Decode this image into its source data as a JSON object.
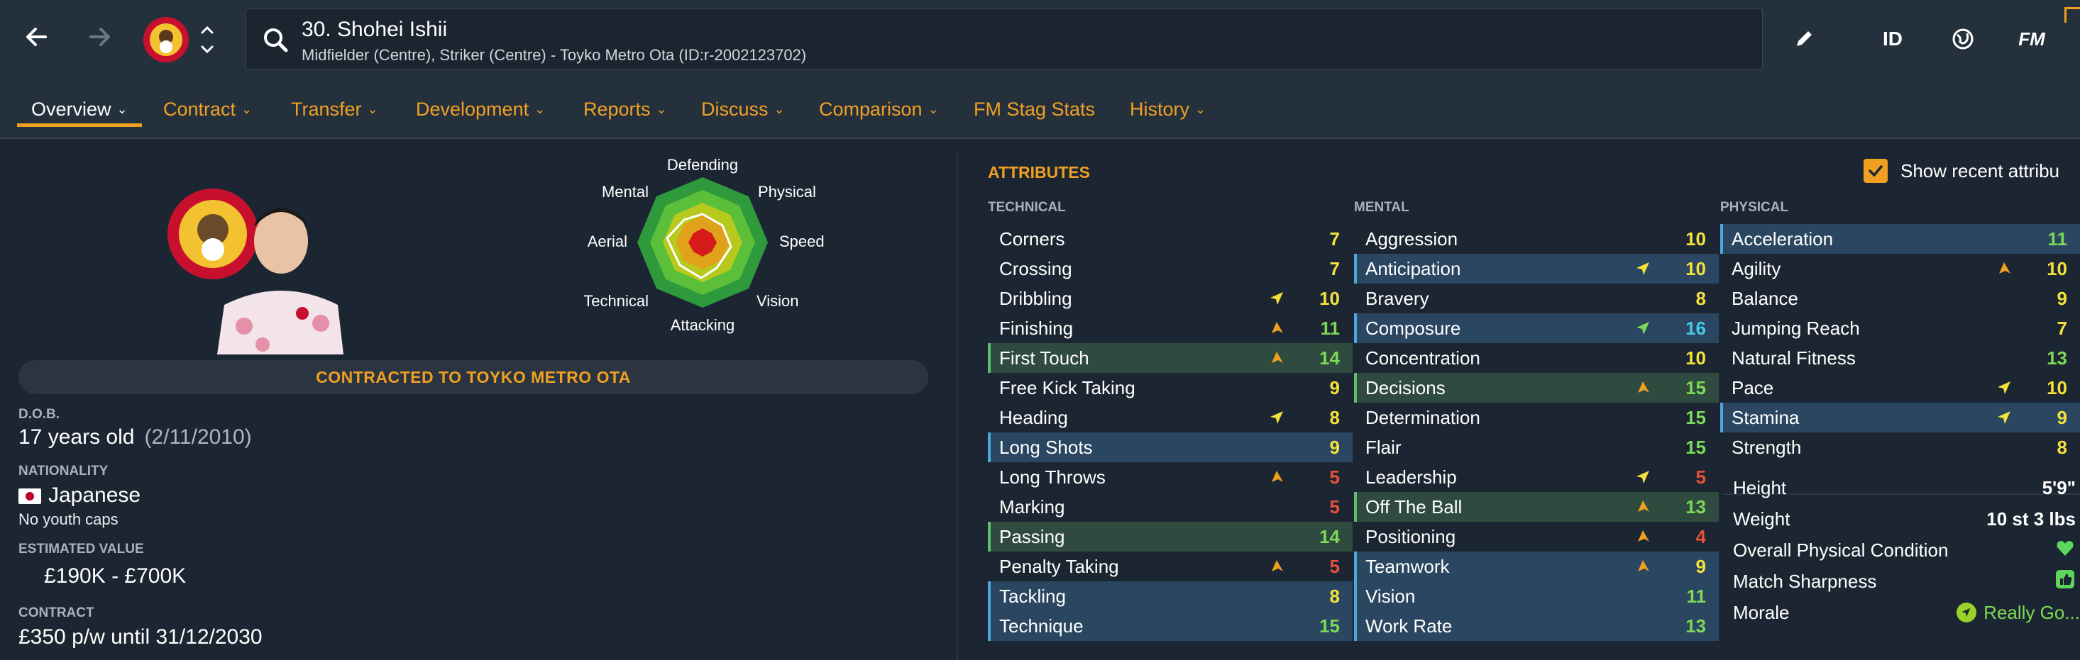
{
  "header": {
    "player_title": "30. Shohei Ishii",
    "player_subtitle": "Midfielder (Centre), Striker (Centre) - Toyko Metro Ota (ID:r-2002123702)",
    "id_label": "ID",
    "fm_label": "FM",
    "accent": "#f0a020"
  },
  "tabs": [
    {
      "label": "Overview"
    },
    {
      "label": "Contract"
    },
    {
      "label": "Transfer"
    },
    {
      "label": "Development"
    },
    {
      "label": "Reports"
    },
    {
      "label": "Discuss"
    },
    {
      "label": "Comparison"
    },
    {
      "label": "FM Stag Stats"
    },
    {
      "label": "History"
    }
  ],
  "radar": {
    "labels": [
      "Defending",
      "Physical",
      "Speed",
      "Vision",
      "Attacking",
      "Technical",
      "Aerial",
      "Mental"
    ]
  },
  "profile": {
    "contract_banner": "CONTRACTED TO TOYKO METRO OTA",
    "dob_label": "D.O.B.",
    "age": "17 years old",
    "dob": "(2/11/2010)",
    "nationality_label": "NATIONALITY",
    "nationality": "Japanese",
    "youth_caps": "No youth caps",
    "value_label": "ESTIMATED VALUE",
    "value": "£190K - £700K",
    "contract_label": "CONTRACT",
    "contract": "£350 p/w until 31/12/2030"
  },
  "attributes": {
    "title": "ATTRIBUTES",
    "show_recent_label": "Show recent attribu",
    "technical_title": "TECHNICAL",
    "mental_title": "MENTAL",
    "physical_title": "PHYSICAL",
    "technical": [
      {
        "name": "Corners",
        "value": "7",
        "color": "yellow",
        "hl": "",
        "arrow": ""
      },
      {
        "name": "Crossing",
        "value": "7",
        "color": "yellow",
        "hl": "",
        "arrow": ""
      },
      {
        "name": "Dribbling",
        "value": "10",
        "color": "yellow",
        "hl": "",
        "arrow": "up-right-yellow"
      },
      {
        "name": "Finishing",
        "value": "11",
        "color": "green",
        "hl": "",
        "arrow": "up-orange"
      },
      {
        "name": "First Touch",
        "value": "14",
        "color": "green",
        "hl": "green",
        "arrow": "up-orange"
      },
      {
        "name": "Free Kick Taking",
        "value": "9",
        "color": "yellow",
        "hl": "",
        "arrow": ""
      },
      {
        "name": "Heading",
        "value": "8",
        "color": "yellow",
        "hl": "",
        "arrow": "up-right-yellow"
      },
      {
        "name": "Long Shots",
        "value": "9",
        "color": "yellow",
        "hl": "blue",
        "arrow": ""
      },
      {
        "name": "Long Throws",
        "value": "5",
        "color": "red",
        "hl": "",
        "arrow": "up-orange"
      },
      {
        "name": "Marking",
        "value": "5",
        "color": "red",
        "hl": "",
        "arrow": ""
      },
      {
        "name": "Passing",
        "value": "14",
        "color": "green",
        "hl": "green",
        "arrow": ""
      },
      {
        "name": "Penalty Taking",
        "value": "5",
        "color": "red",
        "hl": "",
        "arrow": "up-orange"
      },
      {
        "name": "Tackling",
        "value": "8",
        "color": "yellow",
        "hl": "blue",
        "arrow": ""
      },
      {
        "name": "Technique",
        "value": "15",
        "color": "green",
        "hl": "blue",
        "arrow": ""
      }
    ],
    "mental": [
      {
        "name": "Aggression",
        "value": "10",
        "color": "yellow",
        "hl": "",
        "arrow": ""
      },
      {
        "name": "Anticipation",
        "value": "10",
        "color": "yellow",
        "hl": "blue",
        "arrow": "up-right-yellow"
      },
      {
        "name": "Bravery",
        "value": "8",
        "color": "yellow",
        "hl": "",
        "arrow": ""
      },
      {
        "name": "Composure",
        "value": "16",
        "color": "cyan",
        "hl": "blue",
        "arrow": "up-right-green"
      },
      {
        "name": "Concentration",
        "value": "10",
        "color": "yellow",
        "hl": "",
        "arrow": ""
      },
      {
        "name": "Decisions",
        "value": "15",
        "color": "green",
        "hl": "green",
        "arrow": "up-orange"
      },
      {
        "name": "Determination",
        "value": "15",
        "color": "green",
        "hl": "",
        "arrow": ""
      },
      {
        "name": "Flair",
        "value": "15",
        "color": "green",
        "hl": "",
        "arrow": ""
      },
      {
        "name": "Leadership",
        "value": "5",
        "color": "red",
        "hl": "",
        "arrow": "up-right-yellow"
      },
      {
        "name": "Off The Ball",
        "value": "13",
        "color": "green",
        "hl": "green",
        "arrow": "up-orange"
      },
      {
        "name": "Positioning",
        "value": "4",
        "color": "red",
        "hl": "",
        "arrow": "up-orange"
      },
      {
        "name": "Teamwork",
        "value": "9",
        "color": "yellow",
        "hl": "blue",
        "arrow": "up-orange"
      },
      {
        "name": "Vision",
        "value": "11",
        "color": "green",
        "hl": "blue",
        "arrow": ""
      },
      {
        "name": "Work Rate",
        "value": "13",
        "color": "green",
        "hl": "blue",
        "arrow": ""
      }
    ],
    "physical": [
      {
        "name": "Acceleration",
        "value": "11",
        "color": "green",
        "hl": "blue",
        "arrow": ""
      },
      {
        "name": "Agility",
        "value": "10",
        "color": "yellow",
        "hl": "",
        "arrow": "up-orange"
      },
      {
        "name": "Balance",
        "value": "9",
        "color": "yellow",
        "hl": "",
        "arrow": ""
      },
      {
        "name": "Jumping Reach",
        "value": "7",
        "color": "yellow",
        "hl": "",
        "arrow": ""
      },
      {
        "name": "Natural Fitness",
        "value": "13",
        "color": "green",
        "hl": "",
        "arrow": ""
      },
      {
        "name": "Pace",
        "value": "10",
        "color": "yellow",
        "hl": "",
        "arrow": "up-right-yellow"
      },
      {
        "name": "Stamina",
        "value": "9",
        "color": "yellow",
        "hl": "blue",
        "arrow": "up-right-yellow"
      },
      {
        "name": "Strength",
        "value": "8",
        "color": "yellow",
        "hl": "",
        "arrow": ""
      }
    ],
    "extras": [
      {
        "name": "Height",
        "value": "5'9\""
      },
      {
        "name": "Weight",
        "value": "10 st 3 lbs"
      },
      {
        "name": "Overall Physical Condition",
        "value": ""
      },
      {
        "name": "Match Sharpness",
        "value": ""
      },
      {
        "name": "Morale",
        "value": "Really Go..."
      }
    ]
  },
  "colors": {
    "red": "#e8503c",
    "yellow": "#f4e23a",
    "green": "#7ed957",
    "cyan": "#48c8e8",
    "highlight_blue": "#2a4660",
    "highlight_green": "#2f4b40"
  }
}
